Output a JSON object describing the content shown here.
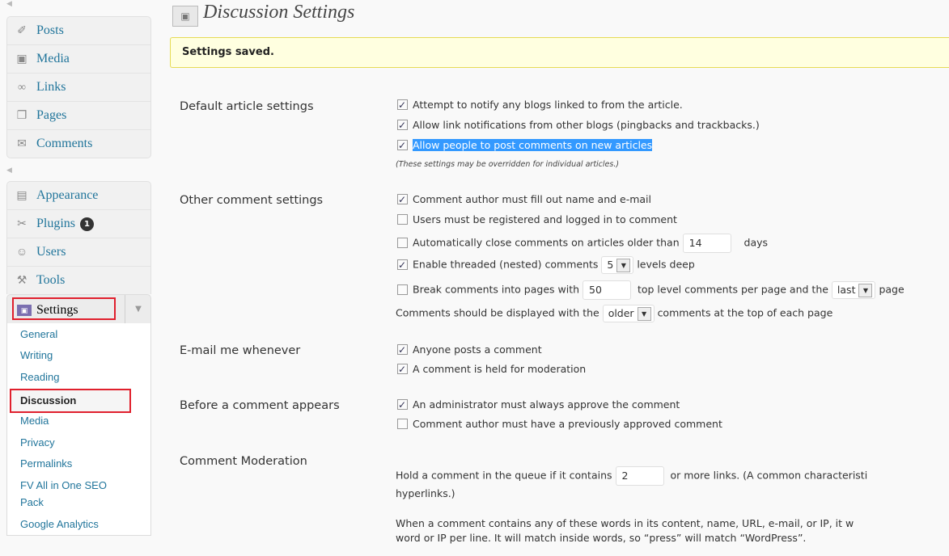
{
  "sidebar": {
    "group1": [
      {
        "label": "Posts",
        "icon": "pin-icon",
        "glyph": "✐"
      },
      {
        "label": "Media",
        "icon": "media-icon",
        "glyph": "▣"
      },
      {
        "label": "Links",
        "icon": "link-icon",
        "glyph": "∞"
      },
      {
        "label": "Pages",
        "icon": "pages-icon",
        "glyph": "❐"
      },
      {
        "label": "Comments",
        "icon": "comment-icon",
        "glyph": "✉"
      }
    ],
    "group2": [
      {
        "label": "Appearance",
        "icon": "appearance-icon",
        "glyph": "▤"
      },
      {
        "label": "Plugins",
        "icon": "plugin-icon",
        "glyph": "✂",
        "badge": "1"
      },
      {
        "label": "Users",
        "icon": "users-icon",
        "glyph": "☺"
      },
      {
        "label": "Tools",
        "icon": "tools-icon",
        "glyph": "⚒"
      }
    ],
    "settings_label": "Settings",
    "submenu": [
      "General",
      "Writing",
      "Reading",
      "Discussion",
      "Media",
      "Privacy",
      "Permalinks",
      "FV All in One SEO",
      "Pack",
      "Google Analytics"
    ]
  },
  "page": {
    "title": "Discussion Settings",
    "notice": "Settings saved."
  },
  "sections": {
    "default_article": "Default article settings",
    "other_comment": "Other comment settings",
    "email_me": "E-mail me whenever",
    "before_appears": "Before a comment appears",
    "moderation": "Comment Moderation"
  },
  "default_article": {
    "notify_blogs": "Attempt to notify any blogs linked to from the article.",
    "allow_pings": "Allow link notifications from other blogs (pingbacks and trackbacks.)",
    "allow_comments": "Allow people to post comments on new articles",
    "note": "(These settings may be overridden for individual articles.)"
  },
  "other_comment": {
    "require_name": "Comment author must fill out name and e-mail",
    "registered": "Users must be registered and logged in to comment",
    "close_prefix": "Automatically close comments on articles older than",
    "close_days": "14",
    "close_suffix": "days",
    "threaded_prefix": "Enable threaded (nested) comments",
    "threaded_depth": "5",
    "threaded_suffix": "levels deep",
    "paginate_prefix": "Break comments into pages with",
    "per_page": "50",
    "paginate_middle": "top level comments per page and the",
    "page_order": "last",
    "paginate_suffix": "page",
    "display_prefix": "Comments should be displayed with the",
    "display_order": "older",
    "display_suffix": "comments at the top of each page"
  },
  "email_me": {
    "anyone_posts": "Anyone posts a comment",
    "held_for_moderation": "A comment is held for moderation"
  },
  "before_appears": {
    "admin_approve": "An administrator must always approve the comment",
    "previously_approved": "Comment author must have a previously approved comment"
  },
  "moderation": {
    "hold_prefix": "Hold a comment in the queue if it contains",
    "links_count": "2",
    "hold_suffix": "or more links. (A common characteristi",
    "hold_line2": "hyperlinks.)",
    "words_line1": "When a comment contains any of these words in its content, name, URL, e-mail, or IP, it w",
    "words_line2": "word or IP per line. It will match inside words, so “press” will match “WordPress”."
  },
  "colors": {
    "link": "#21759b",
    "highlight": "#e0202d",
    "notice_bg": "#ffffe0",
    "selection": "#3399ff"
  }
}
